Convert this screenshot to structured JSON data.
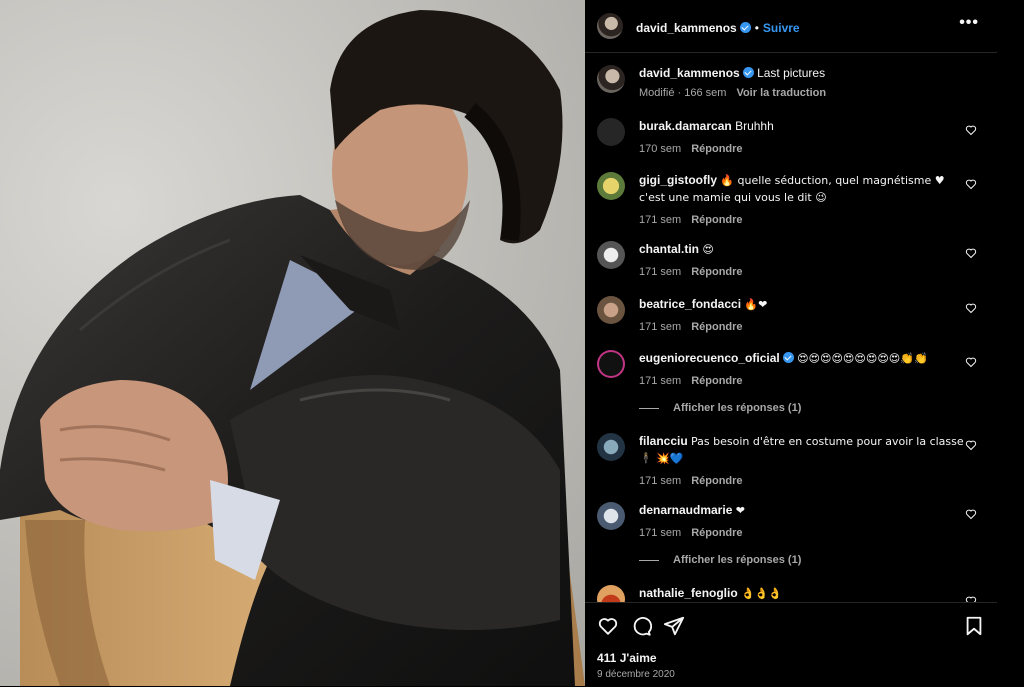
{
  "header": {
    "username": "david_kammenos",
    "dot": "•",
    "follow_label": "Suivre",
    "more": "•••"
  },
  "caption": {
    "username": "david_kammenos",
    "text": "Last pictures",
    "modified": "Modifié · 166 sem",
    "translate": "Voir la traduction"
  },
  "comments": [
    {
      "username": "burak.damarcan",
      "text": "Bruhhh",
      "time": "170 sem",
      "reply": "Répondre",
      "verified": false
    },
    {
      "username": "gigi_gistoofly",
      "text": "🔥 quelle séduction, quel magnétisme ♥ c'est une mamie qui vous le dit 😉",
      "time": "171 sem",
      "reply": "Répondre",
      "verified": false
    },
    {
      "username": "chantal.tin",
      "text": "😍",
      "time": "171 sem",
      "reply": "Répondre",
      "verified": false
    },
    {
      "username": "beatrice_fondacci",
      "text": "🔥❤",
      "time": "171 sem",
      "reply": "Répondre",
      "verified": false
    },
    {
      "username": "eugeniorecuenco_oficial",
      "text": "😍😍😍😍😍😍😍😍😍👏👏",
      "time": "171 sem",
      "reply": "Répondre",
      "verified": true,
      "replies": "Afficher les réponses (1)"
    },
    {
      "username": "filancciu",
      "text": "Pas besoin d'être en costume pour avoir la classe 🕴 💥💙",
      "time": "171 sem",
      "reply": "Répondre",
      "verified": false
    },
    {
      "username": "denarnaudmarie",
      "text": "❤",
      "time": "171 sem",
      "reply": "Répondre",
      "verified": false,
      "replies": "Afficher les réponses (1)"
    },
    {
      "username": "nathalie_fenoglio",
      "text": "👌👌👌",
      "verified": false
    }
  ],
  "footer": {
    "likes": "411 J'aime",
    "date": "9 décembre 2020"
  },
  "icons": {
    "like": "heart-icon",
    "comment": "comment-icon",
    "share": "share-icon",
    "save": "bookmark-icon",
    "verified": "verified-badge-icon"
  },
  "colors": {
    "background": "#000000",
    "accent": "#3797f0",
    "muted": "#a8a8a8"
  }
}
